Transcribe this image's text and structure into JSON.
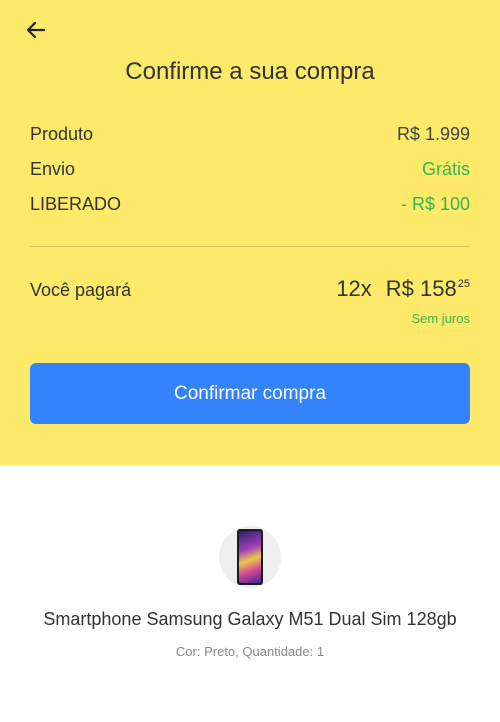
{
  "header": {
    "title": "Confirme a sua compra",
    "back_icon": "arrow-left-icon"
  },
  "summary": {
    "product_label": "Produto",
    "product_value": "R$ 1.999",
    "shipping_label": "Envio",
    "shipping_value": "Grátis",
    "discount_label": "LIBERADO",
    "discount_value": "- R$ 100"
  },
  "payment": {
    "label": "Você pagará",
    "installments": "12x",
    "amount": "R$ 158",
    "cents": "25",
    "interest_note": "Sem juros"
  },
  "actions": {
    "confirm_label": "Confirmar compra"
  },
  "product": {
    "name": "Smartphone Samsung Galaxy M51 Dual Sim  128gb",
    "meta": "Cor: Preto, Quantidade: 1"
  },
  "colors": {
    "panel_bg": "#fde96a",
    "accent_blue": "#3483fa",
    "success_green": "#39b54a"
  }
}
